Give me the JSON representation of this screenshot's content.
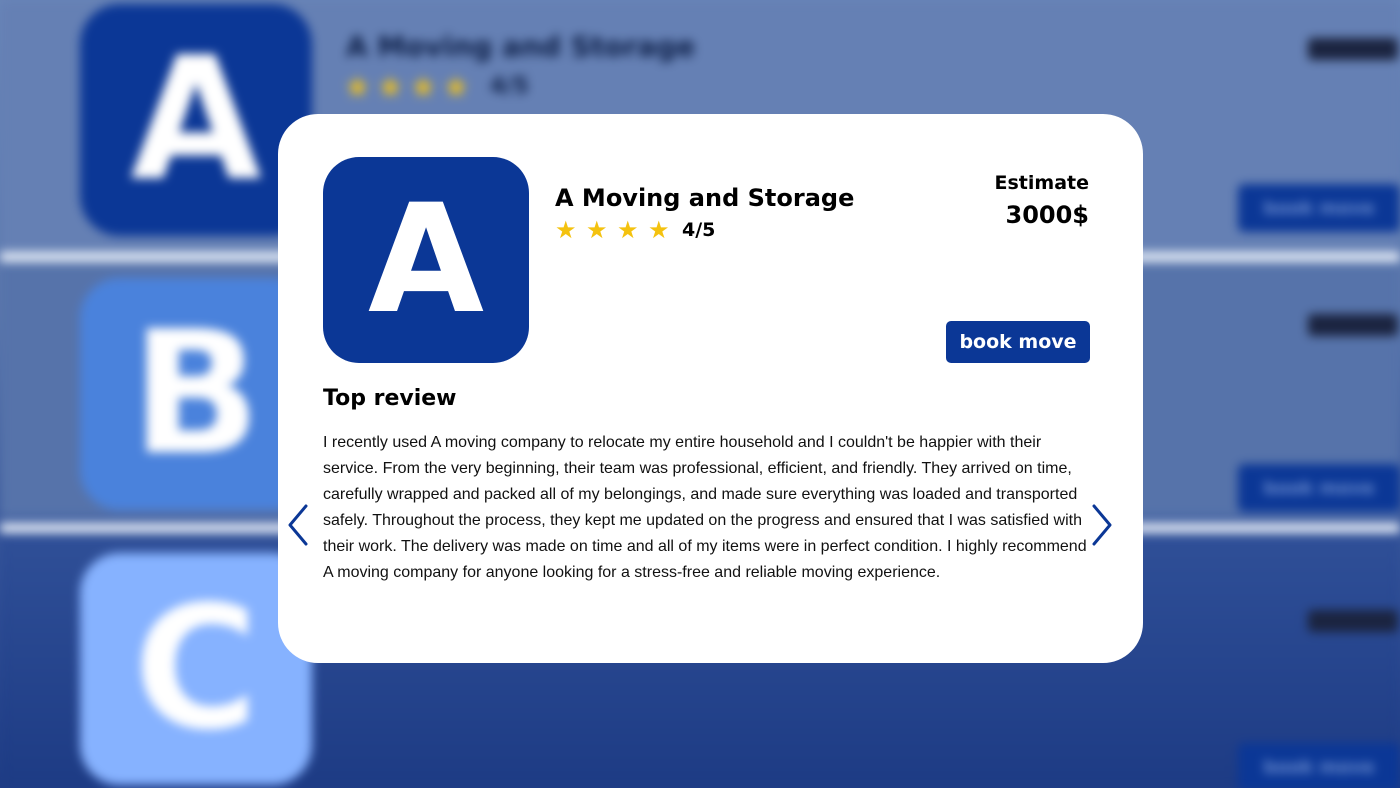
{
  "background": {
    "rows": [
      {
        "letter": "A",
        "title": "A Moving and Storage",
        "stars": "★★★★",
        "score": "4/5",
        "book_label": "book move"
      },
      {
        "letter": "B",
        "book_label": "book move"
      },
      {
        "letter": "C",
        "book_label": "book move"
      }
    ]
  },
  "card": {
    "logo_letter": "A",
    "company_name": "A Moving and Storage",
    "rating": {
      "stars": [
        "★",
        "★",
        "★",
        "★"
      ],
      "value": "4/5",
      "score": 4,
      "max": 5
    },
    "estimate_label": "Estimate",
    "estimate_value": "3000$",
    "book_label": "book move",
    "review_heading": "Top review",
    "review_text": "I recently used A moving company to relocate my entire household and I couldn't be happier with their service. From the very beginning, their team was professional, efficient, and friendly. They arrived on time, carefully wrapped and packed all of my belongings, and made sure everything was loaded and transported safely. Throughout the process, they kept me updated on the progress and ensured that I was satisfied with their work. The delivery was made on time and all of my items were in perfect condition. I highly recommend A moving company for anyone looking for a stress-free and reliable moving experience."
  },
  "icons": {
    "prev": "chevron-left-icon",
    "next": "chevron-right-icon",
    "star": "star-icon"
  },
  "colors": {
    "brand_blue": "#0b3796",
    "star_yellow": "#f4c20f",
    "card_bg": "#ffffff",
    "logo_b": "#4a82dc",
    "logo_c": "#86b2ff"
  }
}
